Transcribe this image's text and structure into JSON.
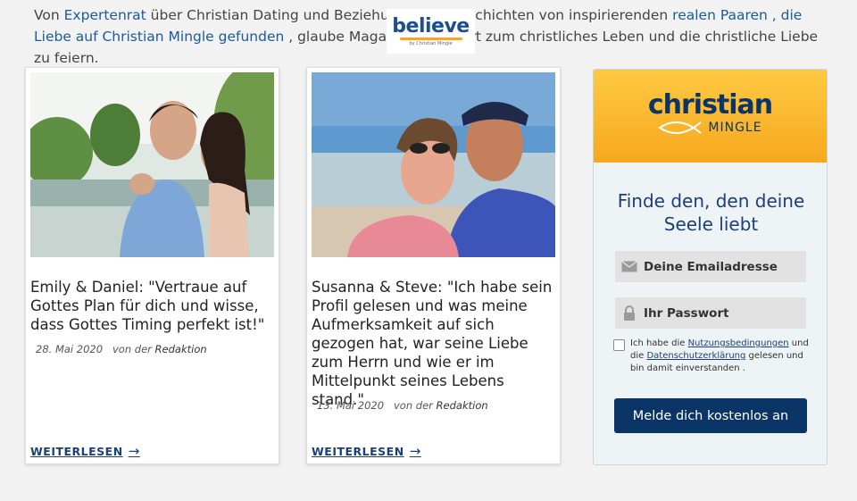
{
  "intro": {
    "t1": "Von ",
    "link_expert": "Expertenrat",
    "t2": " über Christian Dating und Beziehungen ",
    "t2b": "zu Geschichten von inspirierenden ",
    "link_couples": "realen Paaren , die Liebe auf Christian Mingle gefunden",
    "t3": " , glaube Magazin ist der Ort ",
    "t3b": "zum christliches Leben und die christliche Liebe zu feiern."
  },
  "believe_logo": {
    "word": "believe",
    "sub": "by Christian Mingle"
  },
  "cards": [
    {
      "quote": "Emily & Daniel: \"Vertraue auf Gottes Plan für dich und wisse, dass Gottes Timing perfekt ist!\"",
      "date": "28. Mai 2020",
      "by": "von der",
      "author": "Redaktion",
      "more": "WEITERLESEN"
    },
    {
      "quote": "Susanna & Steve: \"Ich habe sein Profil gelesen und was meine Aufmerksamkeit auf sich gezogen hat, war seine Liebe zum Herrn und wie er im Mittelpunkt seines Lebens stand.\"",
      "date": "13. Mai 2020",
      "by": "von der",
      "author": "Redaktion",
      "more": "WEITERLESEN"
    }
  ],
  "signup": {
    "brand_top": "christian",
    "brand_bottom": "MINGLE",
    "headline": "Finde den, den deine Seele liebt",
    "email_placeholder": "Deine Emailadresse",
    "password_placeholder": "Ihr Passwort",
    "terms_t1": "Ich habe die ",
    "terms_link1": "Nutzungsbedingungen",
    "terms_t2": " und die ",
    "terms_link2": "Datenschutzerklärung",
    "terms_t3": " gelesen und bin damit einverstanden .",
    "cta": "Melde dich kostenlos an"
  },
  "colors": {
    "link": "#1a5a9e",
    "brand_navy": "#0b3566",
    "brand_gold": "#f6a81e"
  },
  "icons": [
    "envelope-icon",
    "lock-icon",
    "arrow-right-icon",
    "fish-icon"
  ]
}
